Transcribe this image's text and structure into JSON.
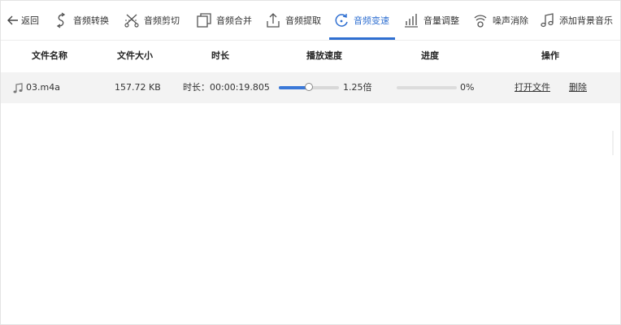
{
  "toolbar": {
    "back": {
      "label": "返回",
      "icon": "arrow-left-icon"
    },
    "items": [
      {
        "label": "音频转换",
        "icon": "convert-icon"
      },
      {
        "label": "音频剪切",
        "icon": "scissors-icon"
      },
      {
        "label": "音频合并",
        "icon": "merge-icon"
      },
      {
        "label": "音频提取",
        "icon": "upload-icon"
      },
      {
        "label": "音频变速",
        "icon": "speed-icon"
      },
      {
        "label": "音量调整",
        "icon": "volume-bars-icon"
      },
      {
        "label": "噪声消除",
        "icon": "noise-icon"
      },
      {
        "label": "添加背景音乐",
        "icon": "music-note-icon"
      }
    ],
    "active_index": 4,
    "accent_color": "#2f6fd1"
  },
  "table": {
    "headers": {
      "name": "文件名称",
      "size": "文件大小",
      "duration": "时长",
      "speed": "播放速度",
      "progress": "进度",
      "actions": "操作"
    },
    "rows": [
      {
        "icon": "music-note-icon",
        "name": "03.m4a",
        "size": "157.72 KB",
        "duration": "时长：00:00:19.805",
        "speed_fraction": 0.5,
        "speed_label": "1.25倍",
        "progress_fraction": 0,
        "progress_label": "0%",
        "open_label": "打开文件",
        "delete_label": "删除"
      }
    ]
  }
}
